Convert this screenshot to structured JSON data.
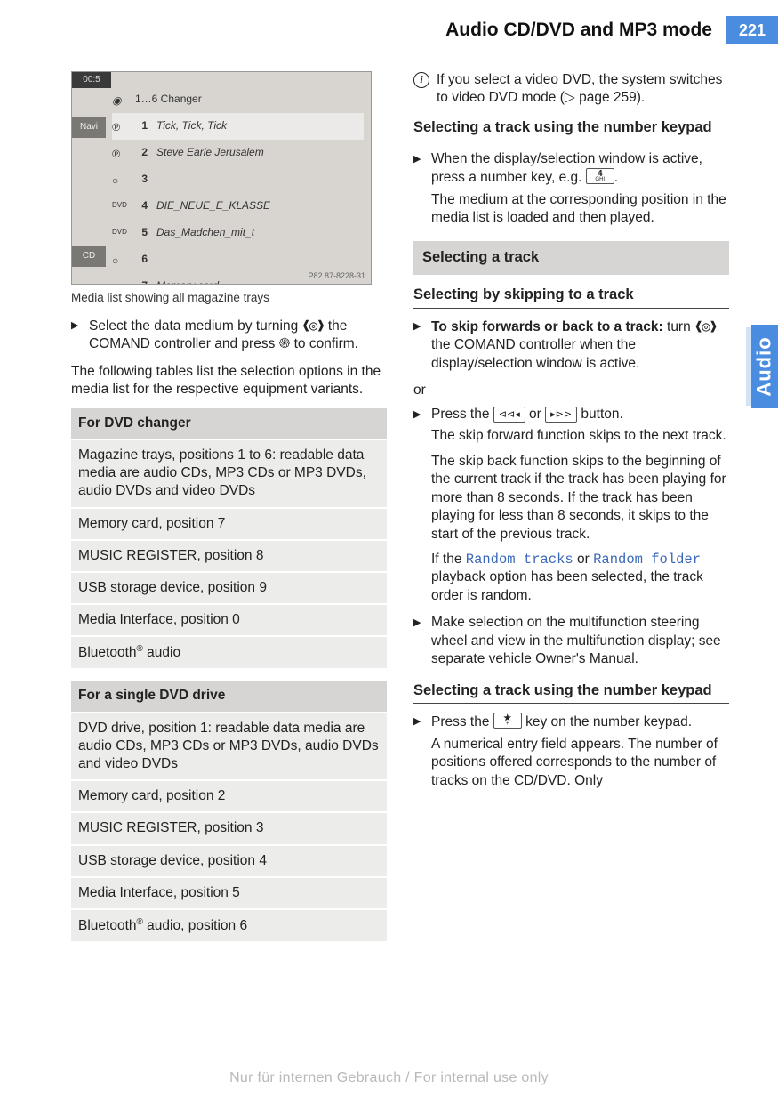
{
  "header": {
    "title": "Audio CD/DVD and MP3 mode",
    "page_number": "221",
    "side_tab": "Audio"
  },
  "screenshot": {
    "time": "00:5",
    "navi": "Navi",
    "cd": "CD",
    "changer_label": "1…6 Changer",
    "rows": [
      {
        "n": "1",
        "label": "Tick, Tick, Tick"
      },
      {
        "n": "2",
        "label": "Steve Earle   Jerusalem"
      },
      {
        "n": "3",
        "label": ""
      },
      {
        "n": "4",
        "label": "DIE_NEUE_E_KLASSE"
      },
      {
        "n": "5",
        "label": "Das_Madchen_mit_t"
      },
      {
        "n": "6",
        "label": ""
      },
      {
        "n": "7",
        "label": "Memory card"
      }
    ],
    "footer_code": "P82.87-8228-31",
    "caption": "Media list showing all magazine trays"
  },
  "left": {
    "step1_a": "Select the data medium by turning ",
    "step1_b": " the COMAND controller and press ",
    "step1_c": " to confirm.",
    "para1": "The following tables list the selection options in the media list for the respective equipment variants.",
    "table1": {
      "head": "For DVD changer",
      "rows": [
        "Magazine trays, positions 1 to 6: readable data media are audio CDs, MP3 CDs or MP3 DVDs, audio DVDs and video DVDs",
        "Memory card, position 7",
        "MUSIC REGISTER, position 8",
        "USB storage device, position 9",
        "Media Interface, position 0",
        "Bluetooth® audio"
      ]
    },
    "table2": {
      "head": "For a single DVD drive",
      "rows": [
        "DVD drive, position 1: readable data media are audio CDs, MP3 CDs or MP3 DVDs, audio DVDs and video DVDs",
        "Memory card, position 2",
        "MUSIC REGISTER, position 3",
        "USB storage device, position 4",
        "Media Interface, position 5",
        "Bluetooth® audio, position 6"
      ]
    }
  },
  "right": {
    "info_a": "If you select a video DVD, the system switches to video DVD mode (",
    "info_page": "page 259",
    "info_b": ").",
    "h_numpad": "Selecting a track using the number keypad",
    "numpad_step_a": "When the display/selection window is active, press a number key, e.g. ",
    "numpad_step_b": ".",
    "numpad_res": "The medium at the corresponding position in the media list is loaded and then played.",
    "section_bar": "Selecting a track",
    "h_skip": "Selecting by skipping to a track",
    "skip_bold": "To skip forwards or back to a track:",
    "skip_rest_a": " turn ",
    "skip_rest_b": " the COMAND controller when the display/selection window is active.",
    "or": "or",
    "press_a": "Press the ",
    "press_b": " or ",
    "press_c": " button.",
    "skip_fwd": "The skip forward function skips to the next track.",
    "skip_back": "The skip back function skips to the beginning of the current track if the track has been playing for more than 8 seconds. If the track has been playing for less than 8 seconds, it skips to the start of the previous track.",
    "random_a": "If the ",
    "random_tracks": "Random tracks",
    "random_mid": " or ",
    "random_folder": "Random folder",
    "random_b": " playback option has been selected, the track order is random.",
    "multi": "Make selection on the multifunction steering wheel and view in the multifunction display; see separate vehicle Owner's Manual.",
    "h_numpad2": "Selecting a track using the number keypad",
    "star_a": "Press the ",
    "star_b": " key on the number keypad.",
    "star_res": "A numerical entry field appears. The number of positions offered corresponds to the number of tracks on the CD/DVD. Only"
  },
  "keys": {
    "four_top": "4",
    "four_bot": "GHI",
    "star_top": "★",
    "star_bot": "+"
  },
  "watermark": "Nur für internen Gebrauch / For internal use only"
}
